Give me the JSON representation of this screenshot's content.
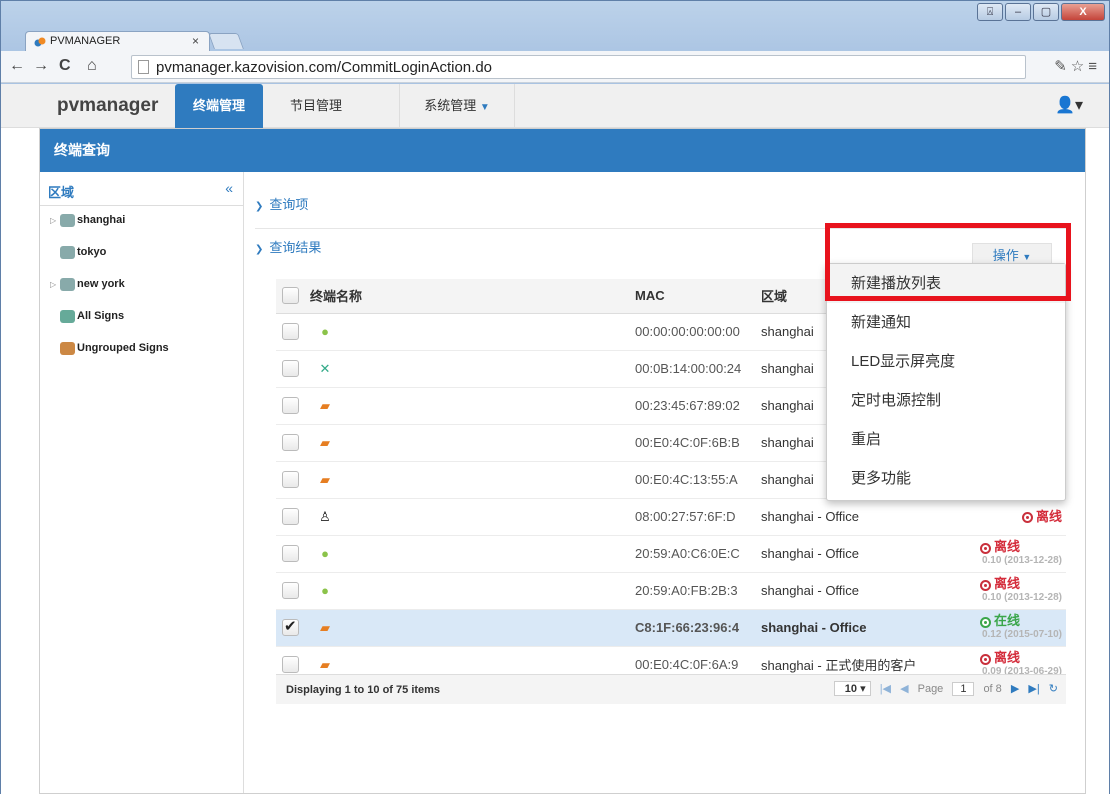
{
  "browser": {
    "tab_title": "PVMANAGER",
    "tab_close": "×",
    "url": "pvmanager.kazovision.com/CommitLoginAction.do",
    "win_buttons": {
      "extra": "⍓",
      "min": "‒",
      "max": "▢",
      "close": "X"
    }
  },
  "topnav": {
    "brand": "pvmanager",
    "items": [
      "终端管理",
      "节目管理",
      "系统管理"
    ]
  },
  "panel": {
    "title": "终端查询"
  },
  "sidebar": {
    "title": "区域",
    "collapse": "«",
    "items": [
      {
        "label": "shanghai",
        "expandable": true,
        "icon": "android-group-icon"
      },
      {
        "label": "tokyo",
        "expandable": false,
        "icon": "android-group-icon"
      },
      {
        "label": "new york",
        "expandable": true,
        "icon": "android-group-icon"
      },
      {
        "label": "All Signs",
        "expandable": false,
        "icon": "all-signs-icon"
      },
      {
        "label": "Ungrouped Signs",
        "expandable": false,
        "icon": "ungrouped-signs-icon"
      }
    ]
  },
  "main": {
    "query_section": "查询项",
    "results_section": "查询结果",
    "ops_button": "操作"
  },
  "table": {
    "columns": [
      "终端名称",
      "MAC",
      "区域"
    ],
    "rows": [
      {
        "os": "android",
        "mac": "00:00:00:00:00:00",
        "region": "shanghai",
        "selected": false
      },
      {
        "os": "x",
        "mac": "00:0B:14:00:00:24",
        "region": "shanghai",
        "selected": false
      },
      {
        "os": "windows",
        "mac": "00:23:45:67:89:02",
        "region": "shanghai",
        "selected": false
      },
      {
        "os": "windows",
        "mac": "00:E0:4C:0F:6B:B",
        "region": "shanghai",
        "selected": false
      },
      {
        "os": "windows",
        "mac": "00:E0:4C:13:55:A",
        "region": "shanghai",
        "selected": false
      },
      {
        "os": "linux",
        "mac": "08:00:27:57:6F:D",
        "region": "shanghai - Office",
        "status": "离线",
        "version": "",
        "selected": false
      },
      {
        "os": "android",
        "mac": "20:59:A0:C6:0E:C",
        "region": "shanghai - Office",
        "status": "离线",
        "version": "0.10 (2013-12-28)",
        "selected": false
      },
      {
        "os": "android",
        "mac": "20:59:A0:FB:2B:3",
        "region": "shanghai - Office",
        "status": "离线",
        "version": "0.10 (2013-12-28)",
        "selected": false
      },
      {
        "os": "windows",
        "mac": "C8:1F:66:23:96:4",
        "region": "shanghai - Office",
        "status": "在线",
        "version": "0.12 (2015-07-10)",
        "selected": true
      },
      {
        "os": "windows",
        "mac": "00:E0:4C:0F:6A:9",
        "region": "shanghai - 正式使用的客户",
        "status": "离线",
        "version": "0.09 (2013-06-29)",
        "selected": false
      }
    ]
  },
  "pager": {
    "display": "Displaying 1 to 10 of 75 items",
    "page_size": "10",
    "page_label": "Page",
    "page": "1",
    "of": "of 8"
  },
  "menu": {
    "items": [
      "新建播放列表",
      "新建通知",
      "LED显示屏亮度",
      "定时电源控制",
      "重启",
      "更多功能"
    ]
  },
  "colors": {
    "accent": "#2f7bbf",
    "offline": "#d42c3b",
    "online": "#3aa64a",
    "highlight": "#e8131d"
  }
}
